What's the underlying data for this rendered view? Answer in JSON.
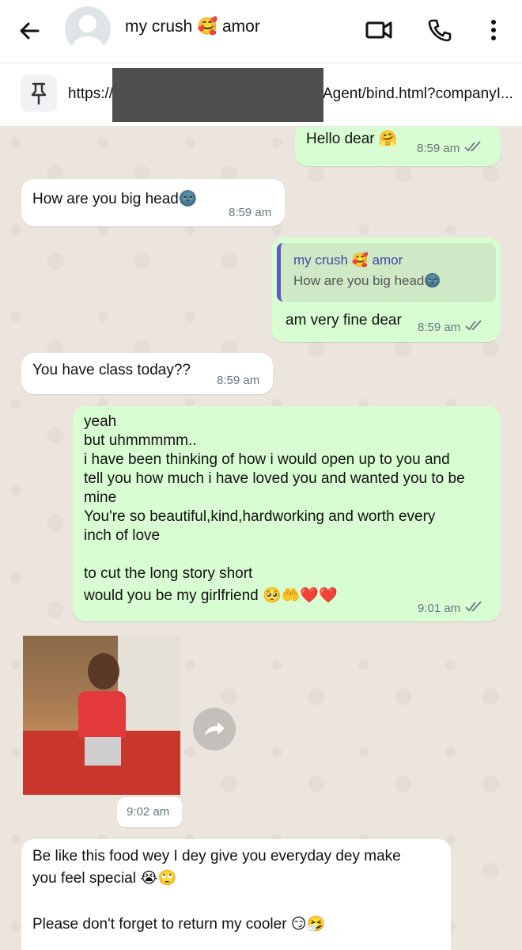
{
  "header": {
    "contact_name": "my crush 🥰 amor",
    "icons": [
      "back-arrow-icon",
      "avatar-placeholder",
      "video-call-icon",
      "phone-icon",
      "more-options-icon"
    ]
  },
  "pinned": {
    "url_start": "https://",
    "url_end": "Agent/bind.html?companyI..."
  },
  "messages": [
    {
      "dir": "out",
      "text": "Hello dear 🤗",
      "time": "8:59 am",
      "read": true
    },
    {
      "dir": "in",
      "text": "How are you big head🌚",
      "time": "8:59 am"
    },
    {
      "dir": "out",
      "quote_name": "my crush 🥰 amor",
      "quote_text": "How are you big head🌚",
      "text": "am very fine dear",
      "time": "8:59 am",
      "read": true
    },
    {
      "dir": "in",
      "text": "You have class today??",
      "time": "8:59 am"
    },
    {
      "dir": "out",
      "lines": [
        "yeah",
        "but uhmmmmm..",
        "i have been thinking of how i would open up to you and",
        "tell you how much i have loved you and wanted you to be",
        "mine",
        "You're so beautiful,kind,hardworking and worth every",
        "inch of love",
        "",
        "to cut the long story short",
        "would you be my girlfriend 🥺🤲❤️❤️"
      ],
      "time": "9:01 am",
      "read": true
    },
    {
      "dir": "in",
      "type": "image",
      "time": "9:02 am"
    },
    {
      "dir": "in",
      "lines": [
        "Be like this food wey I dey give you everyday dey make",
        "you feel special 😭🙄",
        "",
        "Please don't forget to return my cooler 😏🤧"
      ]
    }
  ],
  "colors": {
    "outgoing_bubble": "#d9fdd3",
    "incoming_bubble": "#ffffff",
    "chat_bg": "#ece5dd",
    "tick_color": "#667781"
  }
}
